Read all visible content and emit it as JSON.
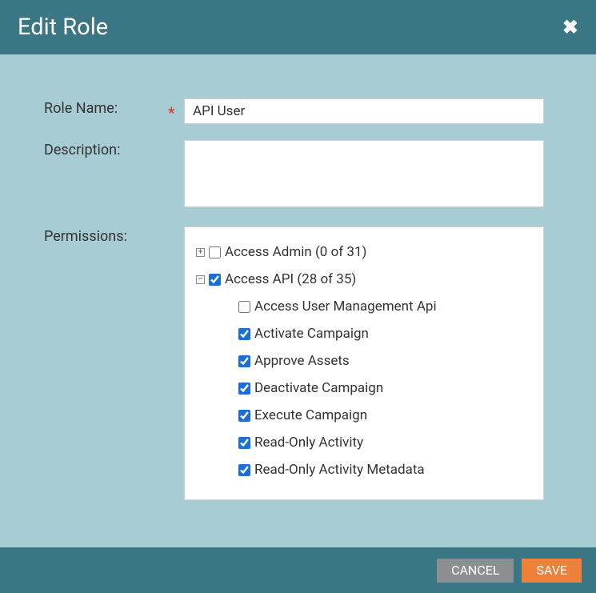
{
  "header": {
    "title": "Edit Role"
  },
  "form": {
    "role_name": {
      "label": "Role Name:",
      "value": "API User"
    },
    "description": {
      "label": "Description:",
      "value": ""
    },
    "permissions": {
      "label": "Permissions:",
      "tree": [
        {
          "label": "Access Admin (0 of 31)",
          "checked": false,
          "expanded": false
        },
        {
          "label": "Access API (28 of 35)",
          "checked": true,
          "expanded": true,
          "children": [
            {
              "label": "Access User Management Api",
              "checked": false
            },
            {
              "label": "Activate Campaign",
              "checked": true
            },
            {
              "label": "Approve Assets",
              "checked": true
            },
            {
              "label": "Deactivate Campaign",
              "checked": true
            },
            {
              "label": "Execute Campaign",
              "checked": true
            },
            {
              "label": "Read-Only Activity",
              "checked": true
            },
            {
              "label": "Read-Only Activity Metadata",
              "checked": true
            }
          ]
        }
      ]
    }
  },
  "footer": {
    "cancel_label": "CANCEL",
    "save_label": "SAVE"
  },
  "icons": {
    "close_glyph": "✖",
    "expand_plus": "+",
    "expand_minus": "−"
  }
}
